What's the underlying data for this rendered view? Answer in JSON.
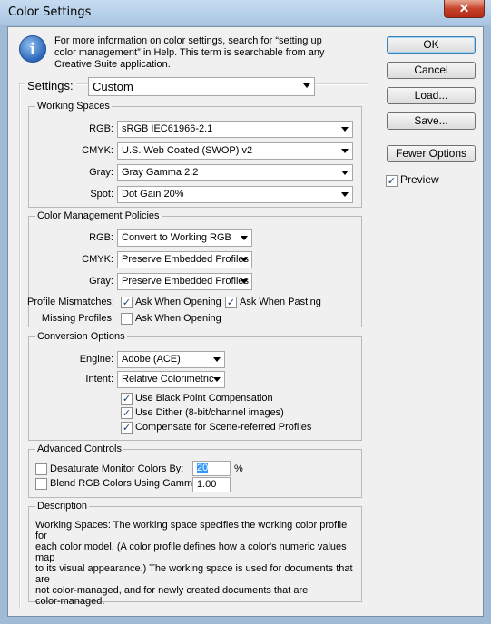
{
  "window": {
    "title": "Color Settings",
    "close_glyph": "✕"
  },
  "info": {
    "icon": "info-icon",
    "lines": [
      "For more information on color settings, search for “setting up",
      "color management” in Help. This term is searchable from any",
      "Creative Suite application."
    ]
  },
  "settings": {
    "label": "Settings:",
    "value": "Custom"
  },
  "working_spaces": {
    "title": "Working Spaces",
    "rgb": {
      "label": "RGB:",
      "value": "sRGB IEC61966-2.1"
    },
    "cmyk": {
      "label": "CMYK:",
      "value": "U.S. Web Coated (SWOP) v2"
    },
    "gray": {
      "label": "Gray:",
      "value": "Gray Gamma 2.2"
    },
    "spot": {
      "label": "Spot:",
      "value": "Dot Gain 20%"
    }
  },
  "policies": {
    "title": "Color Management Policies",
    "rgb": {
      "label": "RGB:",
      "value": "Convert to Working RGB"
    },
    "cmyk": {
      "label": "CMYK:",
      "value": "Preserve Embedded Profiles"
    },
    "gray": {
      "label": "Gray:",
      "value": "Preserve Embedded Profiles"
    },
    "mismatch_label": "Profile Mismatches:",
    "mismatch_opening": {
      "label": "Ask When Opening",
      "checked": true
    },
    "mismatch_pasting": {
      "label": "Ask When Pasting",
      "checked": true
    },
    "missing_label": "Missing Profiles:",
    "missing_opening": {
      "label": "Ask When Opening",
      "checked": false
    }
  },
  "conversion": {
    "title": "Conversion Options",
    "engine": {
      "label": "Engine:",
      "value": "Adobe (ACE)"
    },
    "intent": {
      "label": "Intent:",
      "value": "Relative Colorimetric"
    },
    "black_point": {
      "label": "Use Black Point Compensation",
      "checked": true
    },
    "dither": {
      "label": "Use Dither (8-bit/channel images)",
      "checked": true
    },
    "scene": {
      "label": "Compensate for Scene-referred Profiles",
      "checked": true
    }
  },
  "advanced": {
    "title": "Advanced Controls",
    "desaturate": {
      "label": "Desaturate Monitor Colors By:",
      "value": "20",
      "unit": "%",
      "checked": false
    },
    "blend": {
      "label": "Blend RGB Colors Using Gamma:",
      "value": "1.00",
      "checked": false
    }
  },
  "description": {
    "title": "Description",
    "lines": [
      "Working Spaces:  The working space specifies the working color profile for",
      "each color model.  (A color profile defines how a color's numeric values map",
      "to its visual appearance.)  The working space is used for documents that are",
      "not color-managed, and for newly created documents that are",
      "color-managed."
    ]
  },
  "buttons": {
    "ok": "OK",
    "reset": "Cancel",
    "load": "Load...",
    "save": "Save...",
    "fewer": "Fewer Options"
  },
  "preview": {
    "label": "Preview",
    "checked": true
  },
  "check_glyph": "✓"
}
